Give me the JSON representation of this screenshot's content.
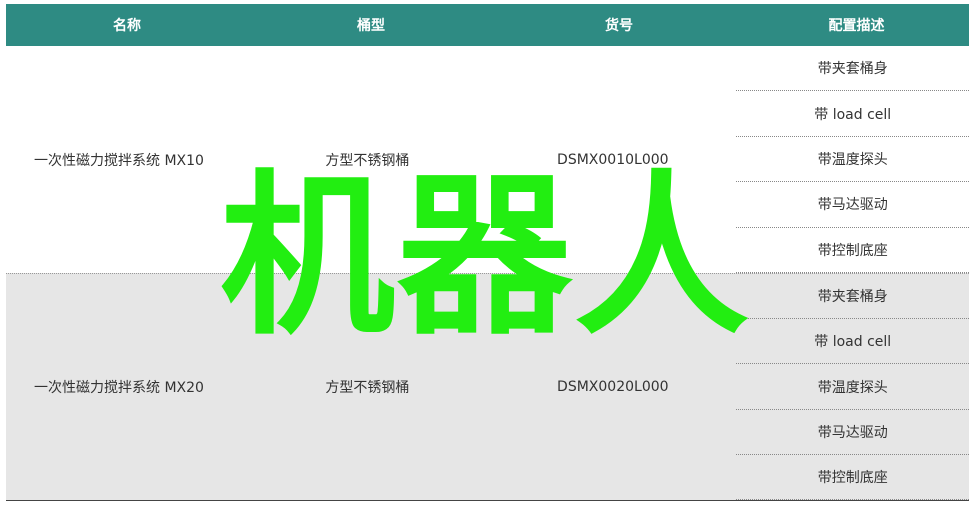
{
  "headers": [
    "名称",
    "桶型",
    "货号",
    "配置描述"
  ],
  "rows": [
    {
      "name": "一次性磁力搅拌系统 MX10",
      "barrel": "方型不锈钢桶",
      "sku": "DSMX0010L000",
      "configs": [
        "带夹套桶身",
        "带 load cell",
        "带温度探头",
        "带马达驱动",
        "带控制底座"
      ]
    },
    {
      "name": "一次性磁力搅拌系统 MX20",
      "barrel": "方型不锈钢桶",
      "sku": "DSMX0020L000",
      "configs": [
        "带夹套桶身",
        "带 load cell",
        "带温度探头",
        "带马达驱动",
        "带控制底座"
      ]
    }
  ],
  "watermark": "机器人",
  "colors": {
    "header_bg": "#2e8b83",
    "watermark": "#22ee11",
    "shaded_row": "#e6e6e6"
  }
}
